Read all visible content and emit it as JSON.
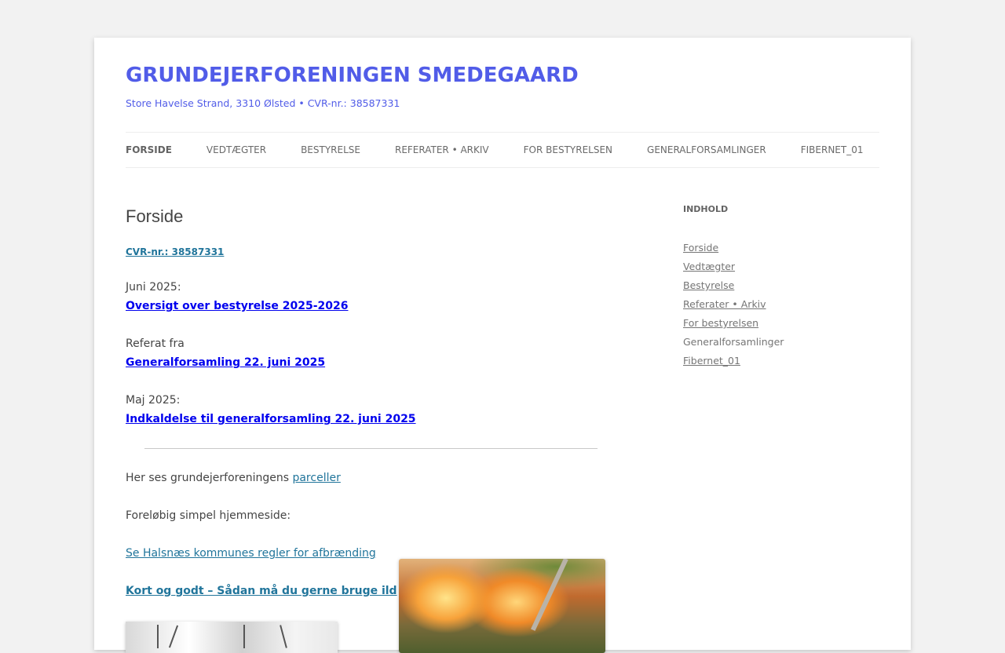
{
  "site": {
    "title": "GRUNDEJERFORENINGEN SMEDEGAARD",
    "description": "Store Havelse Strand, 3310 Ølsted • CVR-nr.: 38587331"
  },
  "nav": {
    "items": [
      {
        "label": "FORSIDE",
        "active": true
      },
      {
        "label": "VEDTÆGTER",
        "active": false
      },
      {
        "label": "BESTYRELSE",
        "active": false
      },
      {
        "label": "REFERATER • ARKIV",
        "active": false
      },
      {
        "label": "FOR BESTYRELSEN",
        "active": false
      },
      {
        "label": "GENERALFORSAMLINGER",
        "active": false
      },
      {
        "label": "FIBERNET_01",
        "active": false
      }
    ]
  },
  "main": {
    "title": "Forside",
    "cvr_link": "CVR-nr.: 38587331",
    "entries": [
      {
        "intro": "Juni 2025:",
        "link": "Oversigt over bestyrelse 2025-2026"
      },
      {
        "intro": "Referat fra",
        "link": "Generalforsamling 22. juni 2025"
      },
      {
        "intro": "Maj 2025:",
        "link": "Indkaldelse til generalforsamling 22. juni 2025"
      }
    ],
    "parceller_text": "Her ses grundejerforeningens",
    "parceller_link": "parceller",
    "simple_text": "Foreløbig simpel hjemmeside:",
    "halsnaes_link": "Se Halsnæs kommunes regler for afbrænding",
    "kort_link": "Kort og godt – Sådan må du gerne bruge ild"
  },
  "sidebar": {
    "title": "INDHOLD",
    "items": [
      {
        "label": "Forside",
        "current": false
      },
      {
        "label": "Vedtægter",
        "current": false
      },
      {
        "label": "Bestyrelse",
        "current": false
      },
      {
        "label": "Referater • Arkiv",
        "current": false
      },
      {
        "label": "For bestyrelsen",
        "current": false
      },
      {
        "label": "Generalforsamlinger",
        "current": true
      },
      {
        "label": "Fibernet_01",
        "current": false
      }
    ]
  },
  "colors": {
    "title": "#515ce8",
    "link": "#21759b",
    "strong_link": "#0000ee",
    "background": "#f2f2f2"
  }
}
